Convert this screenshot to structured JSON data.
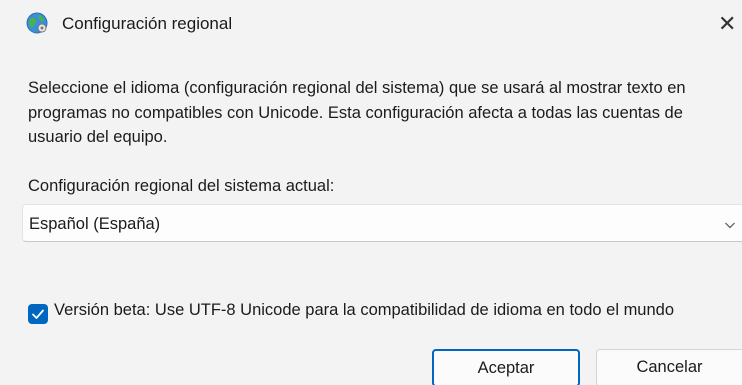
{
  "window": {
    "title": "Configuración regional",
    "title_icon": "globe-icon",
    "close_glyph": "✕",
    "close_icon": "close-icon"
  },
  "content": {
    "description": "Seleccione el idioma (configuración regional del sistema) que se usará al mostrar texto en programas no compatibles con Unicode. Esta configuración afecta a todas las cuentas de usuario del equipo.",
    "locale_label": "Configuración regional del sistema actual:",
    "locale_select": {
      "selected_value": "Español (España)",
      "icon": "chevron-down-icon"
    },
    "beta_checkbox": {
      "checked": true,
      "label": "Versión beta: Use UTF-8 Unicode para la compatibilidad de idioma en todo el mundo"
    }
  },
  "buttons": {
    "accept_label": "Aceptar",
    "cancel_label": "Cancelar"
  },
  "colors": {
    "accent": "#0067c0",
    "background": "#f3f3f3"
  }
}
